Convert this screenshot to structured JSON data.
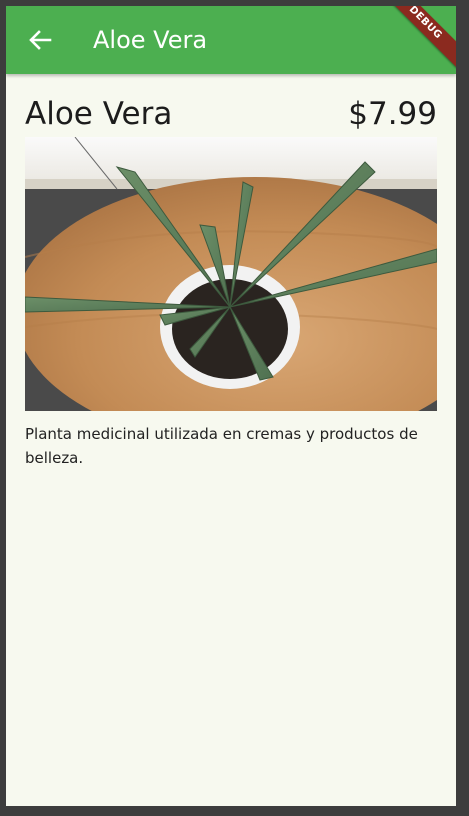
{
  "appbar": {
    "title": "Aloe Vera",
    "back_icon": "arrow-back-icon",
    "color": "#4caf50",
    "debug_banner": "DEBUG"
  },
  "product": {
    "name": "Aloe Vera",
    "price": "$7.99",
    "image_subject": "aloe-vera-plant-in-white-pot",
    "description": "Planta medicinal utilizada en cremas y productos de belleza."
  }
}
